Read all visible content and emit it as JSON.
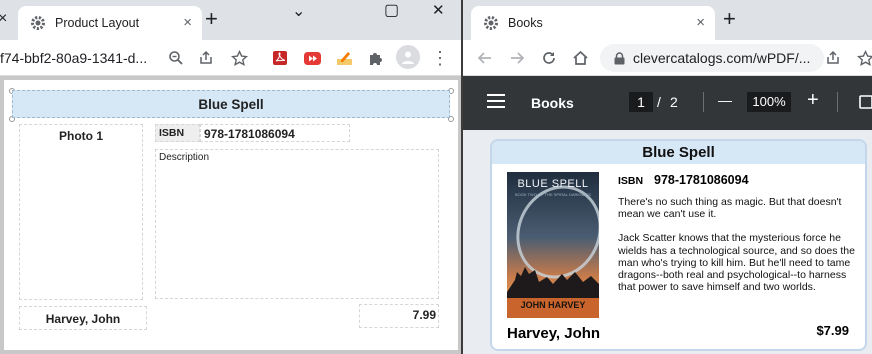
{
  "left_window": {
    "tab_title": "Product Layout",
    "tab_close": "×",
    "new_tab": "+",
    "url": "f74-bbf2-80a9-1341-d...",
    "controls": {
      "minimize": "⌄",
      "restore": "▢",
      "close": "✕"
    },
    "left_tab_close": "×"
  },
  "layout": {
    "title": "Blue Spell",
    "photo_label": "Photo 1",
    "isbn_label": "ISBN",
    "isbn_value": "978-1781086094",
    "description_label": "Description",
    "author": "Harvey, John",
    "price": "7.99"
  },
  "right_window": {
    "tab_title": "Books",
    "tab_close": "×",
    "new_tab": "+",
    "url": "clevercatalogs.com/wPDF/..."
  },
  "pdf": {
    "doc_title": "Books",
    "page_current": "1",
    "page_sep": "/",
    "page_total": "2",
    "zoom_out": "—",
    "zoom": "100%",
    "zoom_in": "+"
  },
  "book": {
    "title": "Blue Spell",
    "isbn_label": "ISBN",
    "isbn_value": "978-1781086094",
    "description_p1": "There's no such thing as magic. But that doesn't mean we can't use it.",
    "description_p2": "Jack Scatter knows that the mysterious force he wields has a technological source, and so does the man who's trying to kill him. But he'll need to tame dragons--both real and psychological--to harness that power to save himself and two worlds.",
    "author": "Harvey, John",
    "price": "$7.99",
    "cover": {
      "title": "BLUE SPELL",
      "subtitle": "BOOK TWO OF THE SPIRAL DARKNESS",
      "author": "JOHN HARVEY"
    }
  }
}
